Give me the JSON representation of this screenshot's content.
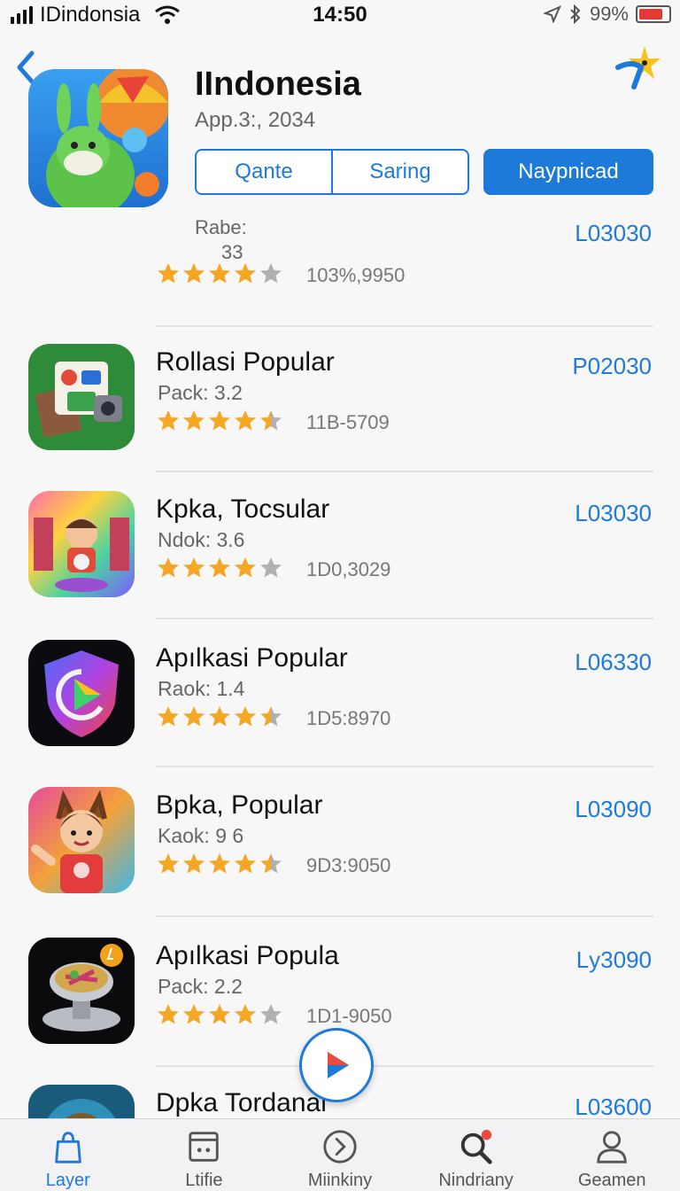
{
  "status": {
    "carrier": "IDindonsia",
    "time": "14:50",
    "battery": "99%"
  },
  "header": {
    "title": "IIndonesia",
    "subtitle": "App.3:, 2034",
    "segment_left": "Qante",
    "segment_right": "Saring",
    "download_label": "Naypnicad",
    "rating_label": "Rabe:",
    "rating_value": "33",
    "count": "103%,9950",
    "price": "L03030",
    "stars": 4
  },
  "apps": [
    {
      "title": "Rollasi Popular",
      "meta": "Pack: 3.2",
      "count": "11B-5709",
      "price": "P02030",
      "stars": 4.5
    },
    {
      "title": "Kpka, Tocsular",
      "meta": "Ndok: 3.6",
      "count": "1D0,3029",
      "price": "L03030",
      "stars": 4
    },
    {
      "title": "Apılkasi Popular",
      "meta": "Raok: 1.4",
      "count": "1D5:8970",
      "price": "L06330",
      "stars": 4.5
    },
    {
      "title": "Bpka, Popular",
      "meta": "Kaok: 9 6",
      "count": "9D3:9050",
      "price": "L03090",
      "stars": 4.5
    },
    {
      "title": "Apılkasi Popula",
      "meta": "Pack: 2.2",
      "count": "1D1-9050",
      "price": "Lу3090",
      "stars": 4
    },
    {
      "title": "Dpka Tordanal",
      "meta": "",
      "count": "",
      "price": "L03600",
      "stars": 0
    }
  ],
  "tabs": [
    {
      "label": "Layer",
      "icon": "bag-icon",
      "active": true
    },
    {
      "label": "Ltifie",
      "icon": "square-icon",
      "active": false
    },
    {
      "label": "Miinkiny",
      "icon": "chevron-circle-icon",
      "active": false
    },
    {
      "label": "Nindriany",
      "icon": "search-icon",
      "active": false
    },
    {
      "label": "Geamen",
      "icon": "person-icon",
      "active": false
    }
  ],
  "colors": {
    "accent": "#1e7ad9",
    "star": "#f5a623",
    "star_empty": "#b0b0b0"
  }
}
